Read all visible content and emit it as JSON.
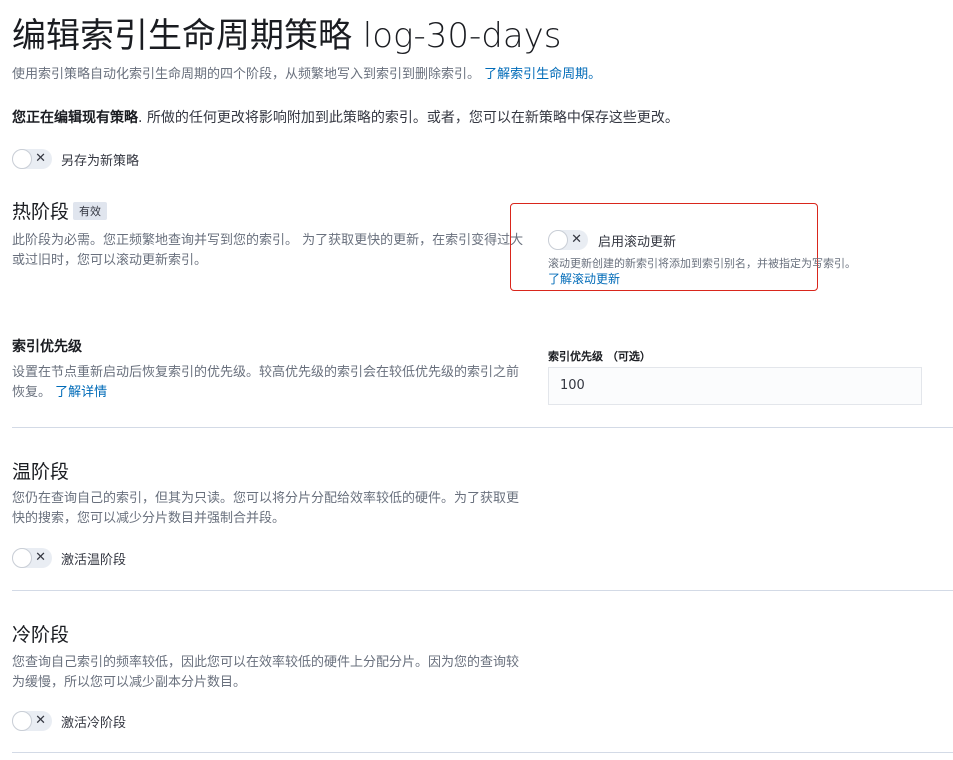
{
  "header": {
    "title": "编辑索引生命周期策略 log-30-days",
    "subtitle": "使用索引策略自动化索引生命周期的四个阶段，从频繁地写入到索引到删除索引。",
    "subtitle_link": "了解索引生命周期。"
  },
  "notice": {
    "bold": "您正在编辑现有策略",
    "text": ". 所做的任何更改将影响附加到此策略的索引。或者，您可以在新策略中保存这些更改。"
  },
  "save_as_new": {
    "label": "另存为新策略",
    "checked": false
  },
  "hot_phase": {
    "title": "热阶段",
    "badge": "有效",
    "description": "此阶段为必需。您正频繁地查询并写到您的索引。 为了获取更快的更新，在索引变得过大或过旧时，您可以滚动更新索引。",
    "rollover_toggle": {
      "label": "启用滚动更新",
      "checked": false
    },
    "rollover_help": "滚动更新创建的新索引将添加到索引别名，并被指定为写索引。",
    "rollover_link": "了解滚动更新"
  },
  "index_priority": {
    "title": "索引优先级",
    "description": "设置在节点重新启动后恢复索引的优先级。较高优先级的索引会在较低优先级的索引之前恢复。",
    "link": "了解详情",
    "field_label": "索引优先级 （可选）",
    "value": "100"
  },
  "warm_phase": {
    "title": "温阶段",
    "description": "您仍在查询自己的索引，但其为只读。您可以将分片分配给效率较低的硬件。为了获取更快的搜索，您可以减少分片数目并强制合并段。",
    "toggle_label": "激活温阶段"
  },
  "cold_phase": {
    "title": "冷阶段",
    "description": "您查询自己索引的频率较低，因此您可以在效率较低的硬件上分配分片。因为您的查询较为缓慢，所以您可以减少副本分片数目。",
    "toggle_label": "激活冷阶段"
  },
  "icons": {
    "toggle_off": "close-icon"
  },
  "colors": {
    "link": "#006bb8",
    "highlight_border": "#d9261c"
  }
}
